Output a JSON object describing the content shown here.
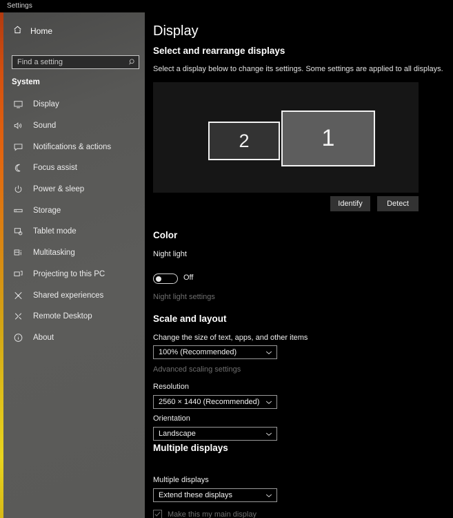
{
  "window": {
    "title": "Settings"
  },
  "sidebar": {
    "home_label": "Home",
    "home_icon": "home-icon",
    "search": {
      "placeholder": "Find a setting",
      "value": "",
      "icon": "search-icon"
    },
    "group_title": "System",
    "items": [
      {
        "label": "Display",
        "icon": "monitor-icon",
        "selected": true
      },
      {
        "label": "Sound",
        "icon": "speaker-icon",
        "selected": false
      },
      {
        "label": "Notifications & actions",
        "icon": "chat-bubble-icon",
        "selected": false
      },
      {
        "label": "Focus assist",
        "icon": "moon-icon",
        "selected": false
      },
      {
        "label": "Power & sleep",
        "icon": "power-icon",
        "selected": false
      },
      {
        "label": "Storage",
        "icon": "drive-icon",
        "selected": false
      },
      {
        "label": "Tablet mode",
        "icon": "tablet-icon",
        "selected": false
      },
      {
        "label": "Multitasking",
        "icon": "multitasking-icon",
        "selected": false
      },
      {
        "label": "Projecting to this PC",
        "icon": "projecting-icon",
        "selected": false
      },
      {
        "label": "Shared experiences",
        "icon": "shared-icon",
        "selected": false
      },
      {
        "label": "Remote Desktop",
        "icon": "remote-desktop-icon",
        "selected": false
      },
      {
        "label": "About",
        "icon": "info-icon",
        "selected": false
      }
    ]
  },
  "main": {
    "page_title": "Display",
    "arrange": {
      "heading": "Select and rearrange displays",
      "description": "Select a display below to change its settings. Some settings are applied to all displays.",
      "monitors": [
        {
          "number": "1",
          "selected": true
        },
        {
          "number": "2",
          "selected": false
        }
      ],
      "identify_button": "Identify",
      "detect_button": "Detect"
    },
    "color": {
      "heading": "Color",
      "night_light_label": "Night light",
      "night_light_state": "Off",
      "night_light_on": false,
      "night_light_settings_link": "Night light settings"
    },
    "scale_and_layout": {
      "heading": "Scale and layout",
      "scale_label": "Change the size of text, apps, and other items",
      "scale_value": "100% (Recommended)",
      "advanced_scaling_link": "Advanced scaling settings",
      "resolution_label": "Resolution",
      "resolution_value": "2560 × 1440 (Recommended)",
      "orientation_label": "Orientation",
      "orientation_value": "Landscape"
    },
    "multiple_displays": {
      "heading": "Multiple displays",
      "field_label": "Multiple displays",
      "field_value": "Extend these displays",
      "main_display_checkbox_label": "Make this my main display",
      "main_display_checked": true,
      "main_display_disabled": true
    }
  },
  "colors": {
    "accent_start": "#b03a10",
    "accent_end": "#e8d41e",
    "sidebar_bg": "#5a5a58",
    "main_bg": "#000000",
    "selected_monitor_fill": "#5d5d5d"
  }
}
